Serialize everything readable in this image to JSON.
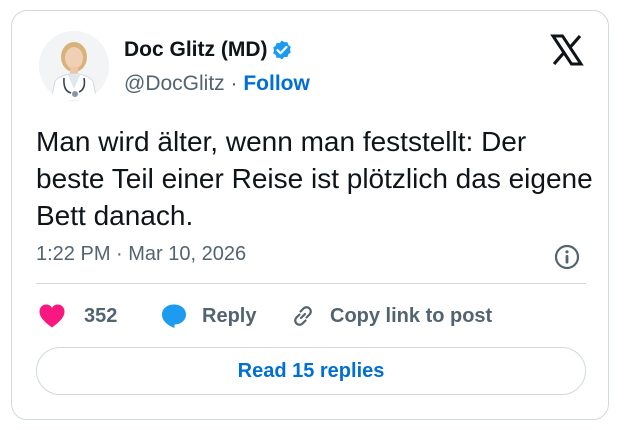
{
  "author": {
    "display_name": "Doc Glitz (MD)",
    "handle": "@DocGlitz",
    "separator": "·",
    "follow_label": "Follow",
    "verified": true,
    "avatar_icon": "avatar-photo"
  },
  "tweet": {
    "text": "Man wird älter, wenn man feststellt: Der beste Teil einer Reise ist plötzlich das eigene Bett danach.",
    "timestamp": "1:22 PM · Mar 10, 2026"
  },
  "actions": {
    "like_count": "352",
    "reply_label": "Reply",
    "copy_link_label": "Copy link to post"
  },
  "footer": {
    "read_replies_label": "Read 15 replies"
  },
  "colors": {
    "accent_blue": "#006fd6",
    "verified_blue": "#1d9bf0",
    "like_pink": "#f91880",
    "text_primary": "#0f1419",
    "text_secondary": "#536471",
    "border": "#cfd9de"
  }
}
